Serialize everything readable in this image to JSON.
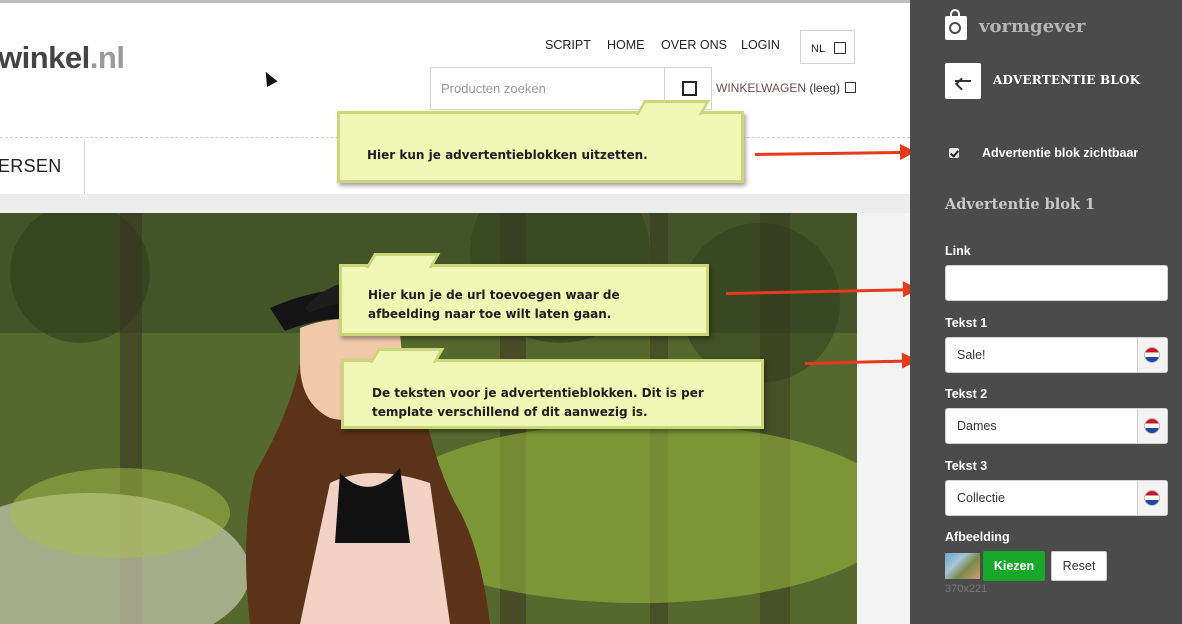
{
  "shop": {
    "logo_main": "winkel",
    "logo_tld": ".nl",
    "nav": [
      "SCRIPT",
      "HOME",
      "OVER ONS",
      "LOGIN"
    ],
    "language": "NL",
    "search_placeholder": "Producten zoeken",
    "cart_label": "WINKELWAGEN",
    "cart_state": "(leeg)",
    "menu_item": "ERSEN"
  },
  "notes": [
    "Hier kun je advertentieblokken uitzetten.",
    "Hier kun je de url toevoegen waar de afbeelding naar toe wilt laten gaan.",
    "De teksten voor je advertentieblokken. Dit is per template verschillend of dit aanwezig is."
  ],
  "editor": {
    "brand": "vormgever",
    "section_title": "ADVERTENTIE BLOK",
    "visible_checkbox_label": "Advertentie blok zichtbaar",
    "visible_checked": true,
    "block_title": "Advertentie blok 1",
    "link_label": "Link",
    "link_value": "",
    "fields": [
      {
        "label": "Tekst 1",
        "value": "Sale!",
        "flag": "dutch-flag-icon"
      },
      {
        "label": "Tekst 2",
        "value": "Dames",
        "flag": "dutch-flag-icon"
      },
      {
        "label": "Tekst 3",
        "value": "Collectie",
        "flag": "dutch-flag-icon"
      }
    ],
    "image_label": "Afbeelding",
    "choose_button": "Kiezen",
    "reset_button": "Reset",
    "image_size": "370x221"
  },
  "colors": {
    "panel_bg": "#4b4b4b",
    "choose_button": "#17a82a",
    "note_bg": "#eef7b4",
    "arrow": "#e63a1d"
  }
}
